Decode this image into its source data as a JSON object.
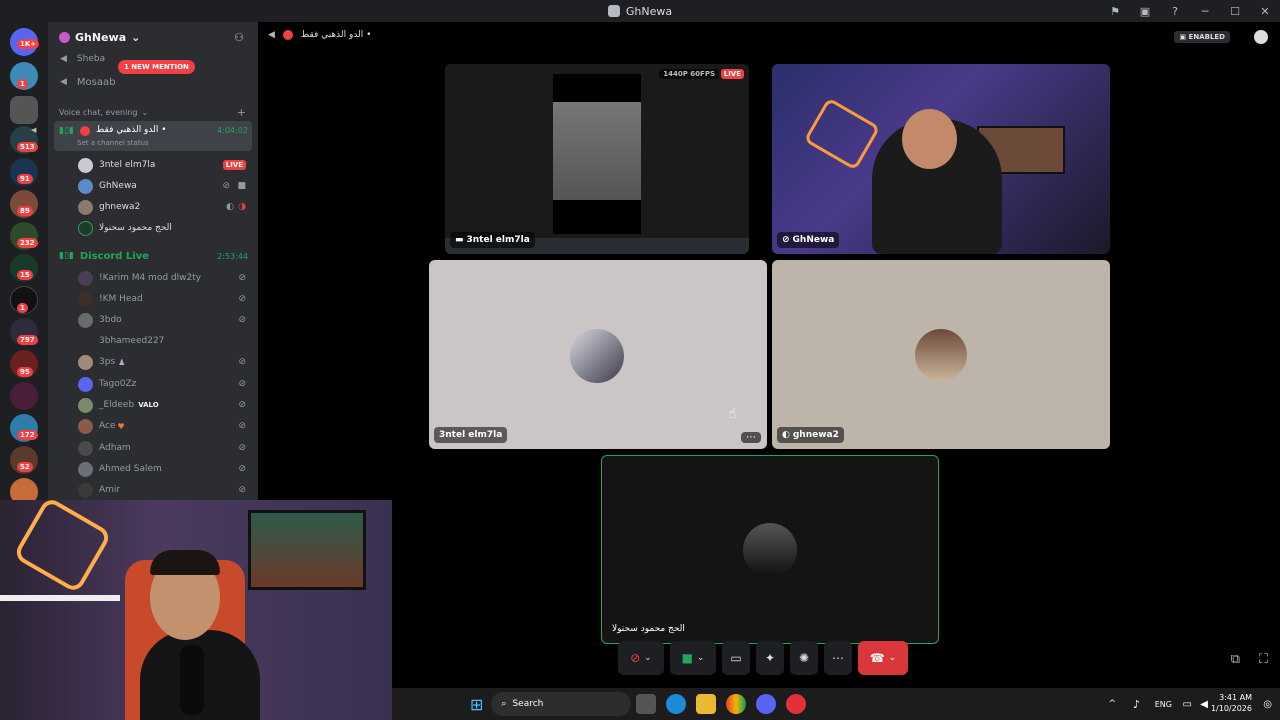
{
  "window": {
    "title": "GhNewa"
  },
  "server": {
    "name": "GhNewa",
    "badges": [
      "1K+",
      "1",
      "513",
      "91",
      "89",
      "232",
      "15",
      "1",
      "797",
      "95",
      "172",
      "52"
    ]
  },
  "sidebar": {
    "text_channels": [
      {
        "label": "Sheba"
      },
      {
        "label": "Mosaab"
      }
    ],
    "mention_pill": "1 NEW MENTION",
    "category": "Voice chat, evening",
    "active_channel": {
      "name": "الدو الذهبي فقط •",
      "status": "Set a channel status",
      "timer": "4:04:02"
    },
    "active_members": [
      {
        "name": "3ntel elm7la",
        "badge": "LIVE"
      },
      {
        "name": "GhNewa"
      },
      {
        "name": "ghnewa2"
      },
      {
        "name": "الحج محمود سحنولا"
      }
    ],
    "second_channel": {
      "name": "Discord Live",
      "timer": "2:53:44"
    },
    "members": [
      {
        "name": "!Karim M4 mod dlw2ty"
      },
      {
        "name": "!KM Head"
      },
      {
        "name": "3bdo"
      },
      {
        "name": "3bhameed227"
      },
      {
        "name": "3ps"
      },
      {
        "name": "Tago0Zz"
      },
      {
        "name": "_Eldeeb",
        "tag": "VALO"
      },
      {
        "name": "Ace"
      },
      {
        "name": "Adham"
      },
      {
        "name": "Ahmed Salem"
      },
      {
        "name": "Amir"
      }
    ]
  },
  "call": {
    "header_channel": "الدو الذهبي فقط •",
    "enabled_badge": "ENABLED",
    "stream_quality": "1440P 60FPS",
    "live_label": "LIVE",
    "tiles": [
      {
        "label": "3ntel elm7la"
      },
      {
        "label": "GhNewa"
      },
      {
        "label": "3ntel elm7la"
      },
      {
        "label": "ghnewa2"
      },
      {
        "label": "الحج محمود سحنولا"
      }
    ]
  },
  "taskbar": {
    "search_placeholder": "Search",
    "lang": "ENG",
    "time": "3:41 AM",
    "date": "1/10/2026"
  },
  "colors": {
    "accent": "#5865f2",
    "danger": "#f23f43",
    "online": "#23a55a",
    "tile_light": "#ccc5c6",
    "tile_beige": "#bdb4aa"
  }
}
